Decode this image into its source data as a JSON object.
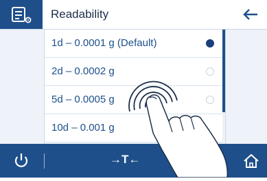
{
  "header": {
    "title": "Readability",
    "back_icon": "arrow-left-icon",
    "section_icon": "settings-list-icon"
  },
  "list": {
    "items": [
      {
        "label": "1d – 0.0001 g (Default)",
        "selected": true
      },
      {
        "label": "2d – 0.0002 g",
        "selected": false
      },
      {
        "label": "5d – 0.0005 g",
        "selected": false
      },
      {
        "label": "10d – 0.001 g",
        "selected": false
      }
    ]
  },
  "footer": {
    "power_icon": "power-icon",
    "tare_label": "→T←",
    "home_icon": "home-icon"
  },
  "colors": {
    "primary": "#1f4f8a",
    "text": "#1d4f8b",
    "background": "#eef3f9"
  }
}
